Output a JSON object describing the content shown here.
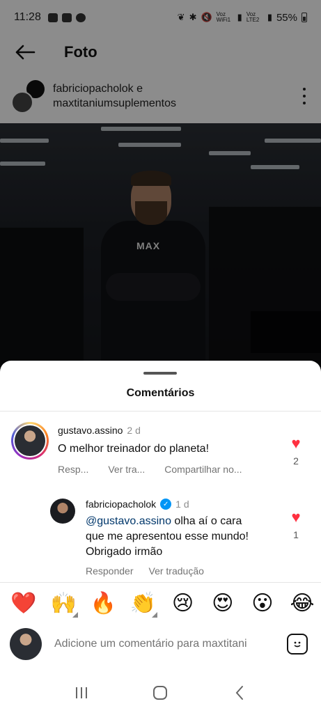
{
  "status_bar": {
    "time": "11:28",
    "network_label_1": "Voz WiFi1",
    "network_label_2": "Voz LTE2",
    "battery": "55%"
  },
  "topbar": {
    "title": "Foto"
  },
  "post": {
    "authors_line1": "fabriciopacholok e",
    "authors_line2": "maxtitaniumsuplementos",
    "shirt_text": "MAX"
  },
  "sheet": {
    "title": "Comentários",
    "comments": [
      {
        "username": "gustavo.assino",
        "time": "2 d",
        "text": "O melhor treinador do planeta!",
        "actions": [
          "Resp...",
          "Ver tra...",
          "Compartilhar no..."
        ],
        "likes": "2"
      },
      {
        "username": "fabriciopacholok",
        "verified": true,
        "time": "1 d",
        "mention": "@gustavo.assino",
        "text_line1_rest": " olha aí o cara",
        "text_line2": "que me apresentou esse mundo!",
        "text_line3": "Obrigado irmão",
        "actions": [
          "Responder",
          "Ver tradução"
        ],
        "likes": "1"
      }
    ],
    "reactions": [
      "❤️",
      "🙌",
      "🔥",
      "👏",
      "😢",
      "😍",
      "😮",
      "😂"
    ],
    "composer_placeholder": "Adicione um comentário para maxtitani",
    "accent_color": "#0095f6",
    "like_color": "#ff3040"
  },
  "navbar": {
    "recent": "|||",
    "home": "◯",
    "back": "‹"
  }
}
